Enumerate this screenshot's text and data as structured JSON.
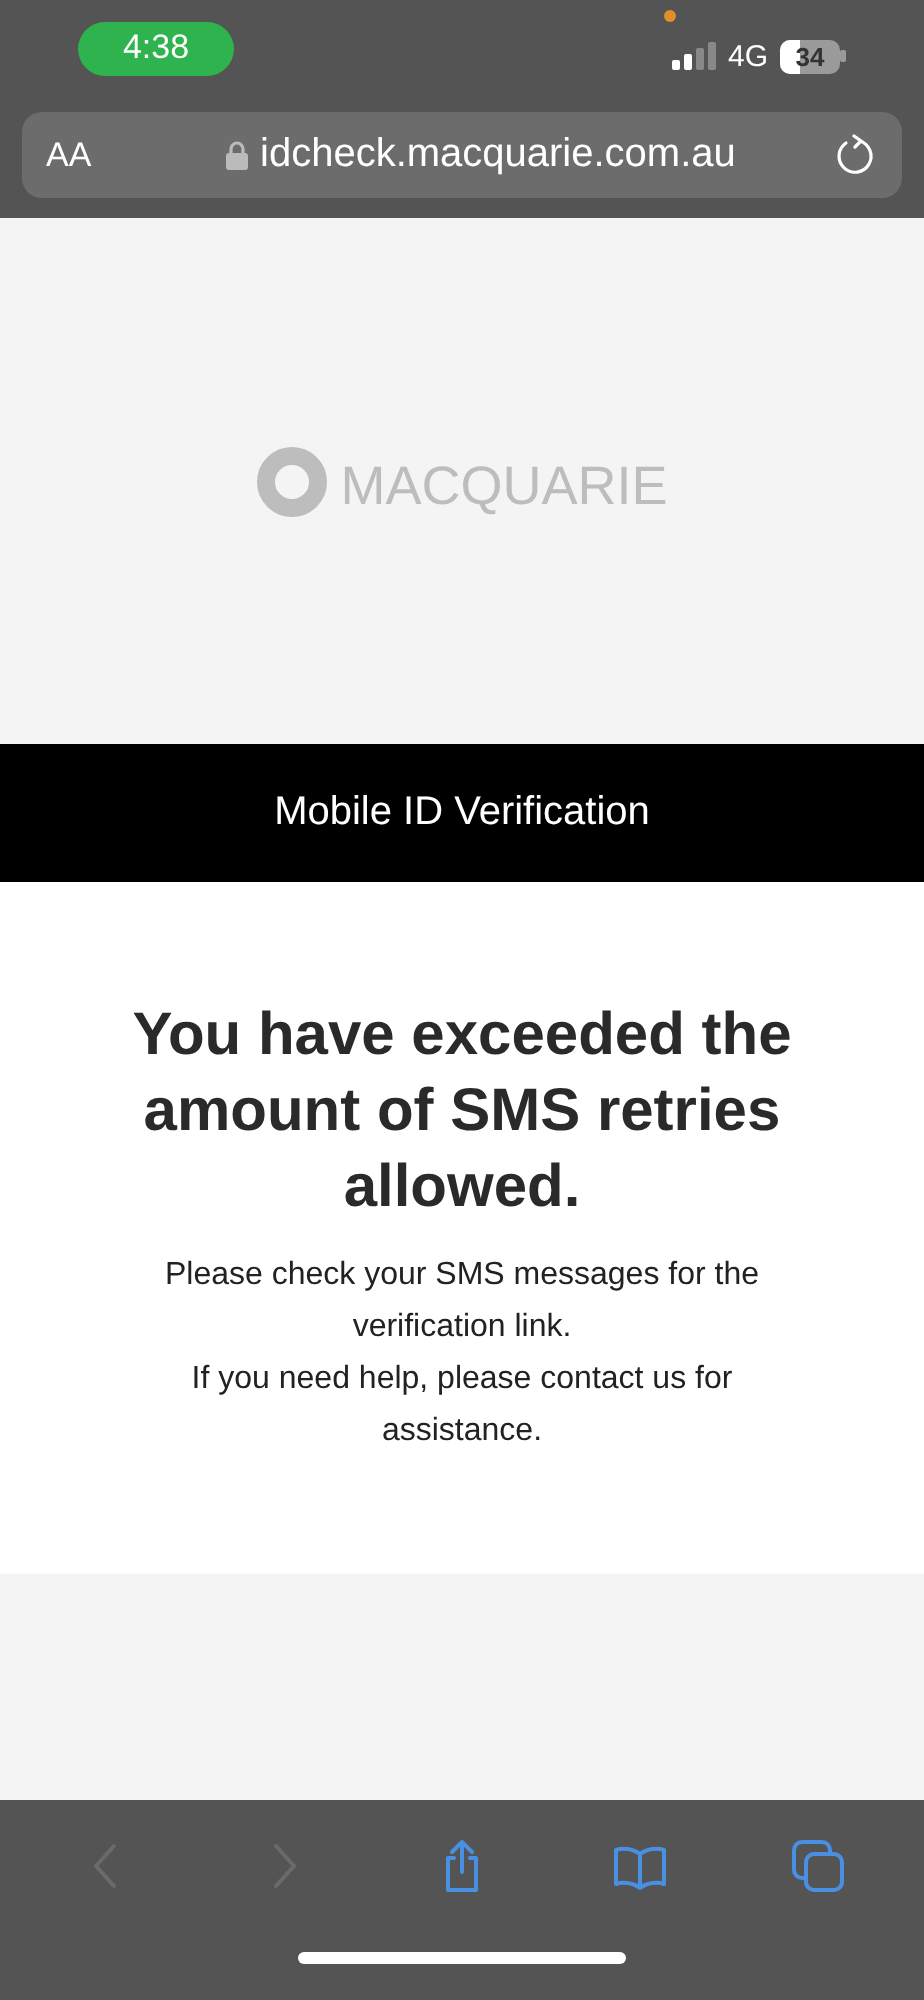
{
  "status_bar": {
    "time": "4:38",
    "network": "4G",
    "battery": "34"
  },
  "address_bar": {
    "text_size": "AA",
    "url": "idcheck.macquarie.com.au"
  },
  "page": {
    "logo": "MACQUARIE",
    "banner": "Mobile ID Verification",
    "heading": "You have exceeded the amount of SMS retries allowed.",
    "lines": [
      "Please check your SMS messages for the verification link.",
      "If you need help, please contact us for assistance."
    ]
  },
  "toolbar": [
    {
      "kind": "back",
      "disabled": true
    },
    {
      "kind": "forward",
      "disabled": true
    },
    {
      "kind": "share",
      "disabled": false
    },
    {
      "kind": "bookmarks",
      "disabled": false
    },
    {
      "kind": "tabs",
      "disabled": false
    }
  ]
}
